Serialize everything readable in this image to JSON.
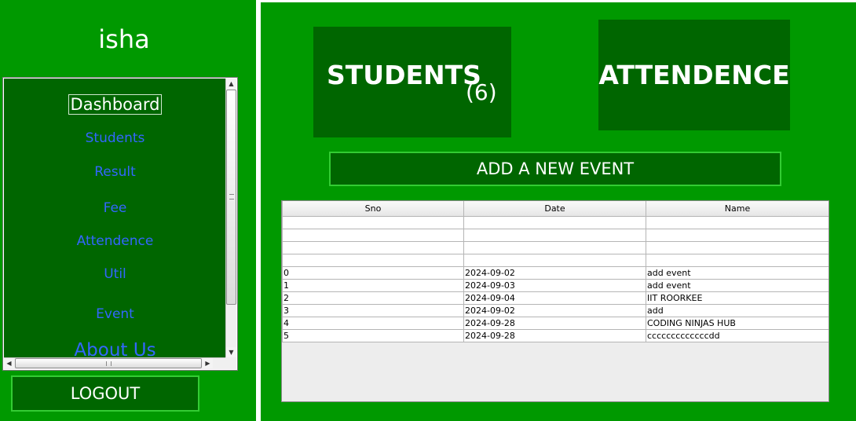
{
  "sidebar": {
    "user_name": "isha",
    "nav_items": [
      {
        "label": "Dashboard"
      },
      {
        "label": "Students"
      },
      {
        "label": "Result"
      },
      {
        "label": "Fee"
      },
      {
        "label": "Attendence"
      },
      {
        "label": "Util"
      },
      {
        "label": "Event"
      },
      {
        "label": "About Us"
      }
    ],
    "logout_label": "LOGOUT"
  },
  "main": {
    "students_label": "STUDENTS",
    "students_count": "(6)",
    "attendence_label": "ATTENDENCE",
    "add_event_label": "ADD A  NEW EVENT",
    "table": {
      "columns": [
        "Sno",
        "Date",
        "Name"
      ],
      "rows": [
        [
          "",
          "",
          ""
        ],
        [
          "",
          "",
          ""
        ],
        [
          "",
          "",
          ""
        ],
        [
          "",
          "",
          ""
        ],
        [
          "0",
          "2024-09-02",
          "add event"
        ],
        [
          "1",
          "2024-09-03",
          "add event"
        ],
        [
          "2",
          "2024-09-04",
          "IIT ROORKEE"
        ],
        [
          "3",
          "2024-09-02",
          "add"
        ],
        [
          "4",
          "2024-09-28",
          "CODING NINJAS HUB"
        ],
        [
          "5",
          "2024-09-28",
          "cccccccccccccdd"
        ]
      ]
    }
  },
  "colors": {
    "panel_bg": "#009900",
    "tile_bg": "#006600",
    "nav_link": "#3366ff",
    "button_border": "#33cc33"
  },
  "icons": {
    "scroll_up": "arrow-up-icon",
    "scroll_down": "arrow-down-icon",
    "scroll_left": "arrow-left-icon",
    "scroll_right": "arrow-right-icon"
  }
}
